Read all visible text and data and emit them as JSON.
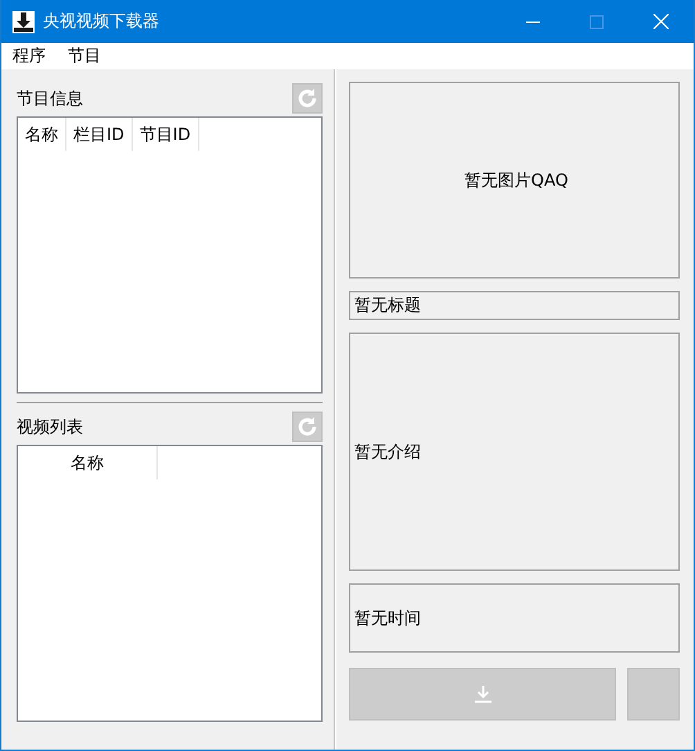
{
  "window": {
    "title": "央视视频下载器"
  },
  "menu": [
    {
      "label": "程序"
    },
    {
      "label": "节目"
    }
  ],
  "program_info": {
    "label": "节目信息",
    "refresh_disabled": true,
    "columns": [
      "名称",
      "栏目ID",
      "节目ID"
    ]
  },
  "video_list": {
    "label": "视频列表",
    "refresh_disabled": true,
    "columns": [
      "名称"
    ]
  },
  "details": {
    "image_placeholder": "暂无图片QAQ",
    "title": "暂无标题",
    "intro": "暂无介绍",
    "time": "暂无时间"
  },
  "download_button": {
    "disabled": true
  },
  "extra_button": {
    "disabled": true
  }
}
